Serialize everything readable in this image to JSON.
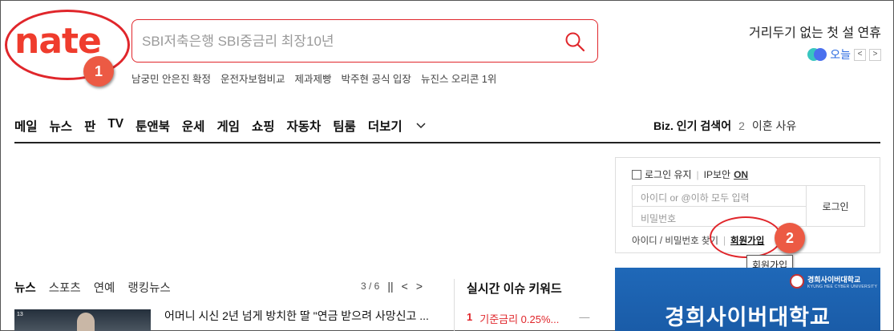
{
  "logo": {
    "text": "nate"
  },
  "markers": [
    "1",
    "2"
  ],
  "search": {
    "placeholder": "SBI저축은행 SBI중금리 최장10년"
  },
  "trending": [
    "남궁민 안은진 확정",
    "운전자보험비교",
    "제과제빵",
    "박주현 공식 입장",
    "뉴진스 오리콘 1위"
  ],
  "promo": {
    "text": "거리두기 없는 첫 설 연휴",
    "today_label": "오늘",
    "prev": "<",
    "next": ">"
  },
  "nav": {
    "items": [
      "메일",
      "뉴스",
      "판",
      "TV",
      "툰앤북",
      "운세",
      "게임",
      "쇼핑",
      "자동차",
      "팀룸"
    ],
    "more": "더보기"
  },
  "biz": {
    "label": "Biz. 인기 검색어",
    "rank": "2",
    "keyword": "이혼 사유"
  },
  "login": {
    "keep_login": "로그인 유지",
    "ip_security": "IP보안",
    "ip_state": "ON",
    "id_placeholder": "아이디 or @이하 모두 입력",
    "pw_placeholder": "비밀번호",
    "button": "로그인",
    "find": "아이디 / 비밀번호 찾기",
    "signup": "회원가입",
    "tooltip": "회원가입"
  },
  "news": {
    "tabs": [
      "뉴스",
      "스포츠",
      "연예",
      "랭킹뉴스"
    ],
    "page": "3 / 6",
    "pause": "||",
    "prev": "<",
    "next": ">",
    "thumb_num": "13",
    "headline": "어머니 시신 2년 넘게 방치한 딸 \"연금 받으려 사망신고 ..."
  },
  "realtime": {
    "title": "실시간 이슈 키워드",
    "items": [
      {
        "rank": "1",
        "keyword": "기준금리 0.25%...",
        "trend": "—"
      }
    ]
  },
  "ad": {
    "brand": "경희사이버대학교",
    "brand_sub": "KYUNG HEE CYBER UNIVERSITY",
    "title": "경희사이버대학교",
    "bg_color": "#1f68b8"
  },
  "colors": {
    "brand": "#ef3c2d",
    "annotation": "#e0262b",
    "accent_blue": "#2a6ae0"
  }
}
